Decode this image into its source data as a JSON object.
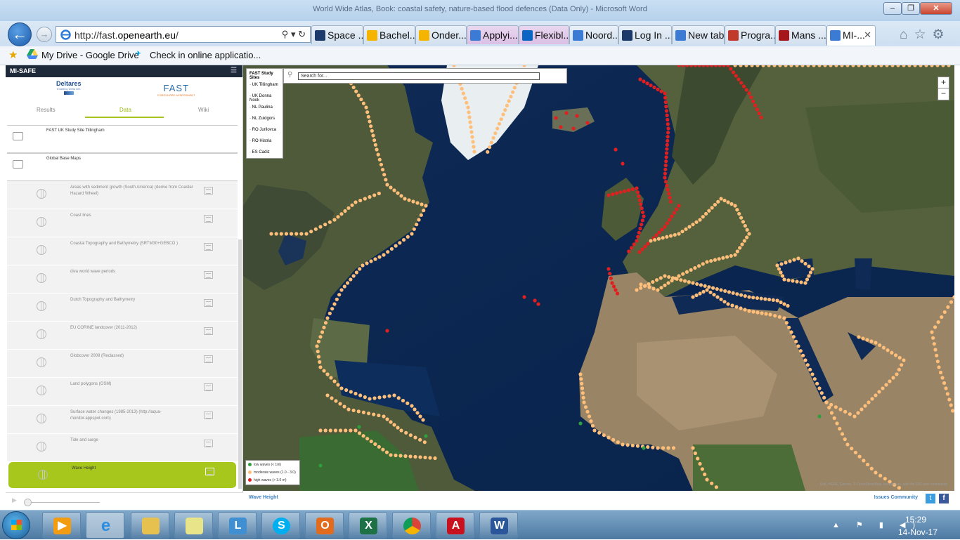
{
  "window": {
    "title": "World Wide Atlas, Book: coastal safety, nature-based flood defences (Data Only) - Microsoft Word"
  },
  "browser": {
    "url_prefix": "http://fast.",
    "url_domain": "openearth.eu",
    "url_suffix": "/",
    "tabs": [
      {
        "label": "Space ...",
        "color": "#1b3a6b"
      },
      {
        "label": "Bachel...",
        "color": "#f4b400"
      },
      {
        "label": "Onder...",
        "color": "#f4b400"
      },
      {
        "label": "Applyi...",
        "color": "#3b7bd4"
      },
      {
        "label": "Flexibl...",
        "color": "#0a66c2"
      },
      {
        "label": "Noord...",
        "color": "#3b7bd4"
      },
      {
        "label": "Log In ...",
        "color": "#1b3a6b"
      },
      {
        "label": "New tab",
        "color": "#3b7bd4"
      },
      {
        "label": "Progra...",
        "color": "#c0392b"
      },
      {
        "label": "Mans ...",
        "color": "#a4161a"
      },
      {
        "label": "MI-...",
        "color": "#3b7bd4"
      }
    ],
    "favorites": {
      "drive": "My Drive - Google Drive",
      "klm": "Check in online applicatio..."
    }
  },
  "app": {
    "name": "MI-SAFE",
    "logos": {
      "deltares": "Deltares",
      "deltares_tag": "Enabling Delta Life",
      "fast": "FAST",
      "fast_tag": "FORESHORE ASSESSMENT"
    },
    "tabs": {
      "results": "Results",
      "data": "Data",
      "wiki": "Wiki"
    },
    "groups": [
      "FAST UK Study Site Tillingham",
      "Global Base Maps"
    ],
    "layers": [
      "Areas with sediment growth (South America) (derive from Coastal Hazard Wheel)",
      "Coast lines",
      "Coastal Topography and Bathymetry (SRTM30+GEBCO )",
      "diva world wave periods",
      "Dutch Topography and Bathymetry",
      "EU CORINE landcover (2011-2012)",
      "Globcover 2009 (Reclassed)",
      "Land polygons (OSM)",
      "Surface water changes (1985-2013) (http://aqua-monitor.appspot.com)",
      "Tide and surge",
      "Wave Height"
    ],
    "study_sites": {
      "title": "FAST Study Sites",
      "items": [
        "UK Tillingham",
        "UK Donna Nook",
        "NL Paulina",
        "NL Zuidgors",
        "RO Jurilovca",
        "RO Histria",
        "ES Cadiz"
      ]
    },
    "search": {
      "placeholder": "Search for..."
    },
    "zoom": {
      "in": "+",
      "out": "−"
    },
    "legend": [
      {
        "label": "low waves (< 1m)",
        "color": "#2e9e3e"
      },
      {
        "label": "moderate waves (1.0 - 3.0)",
        "color": "#ffbf7a"
      },
      {
        "label": "high waves (> 3.0 m)",
        "color": "#e02020"
      }
    ],
    "attribution": "Esri, HERE, Garmin, © OpenStreetMap contributors, and the GIS user community",
    "footer": {
      "active_layer": "Wave Height",
      "issues": "Issues",
      "community": "Community"
    }
  },
  "taskbar": {
    "time": "15:29",
    "date": "14-Nov-17"
  }
}
